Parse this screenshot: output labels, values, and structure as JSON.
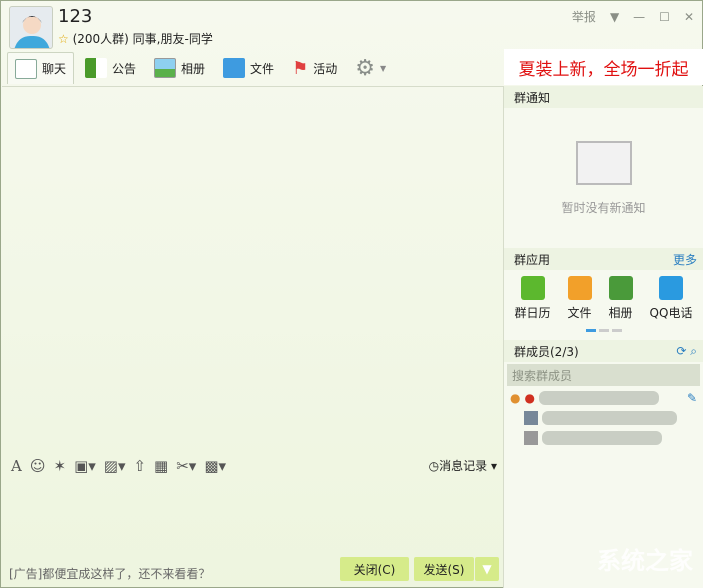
{
  "header": {
    "title": "123",
    "subtitle": "(200人群) 同事,朋友-同学",
    "report": "举报"
  },
  "tabs": [
    {
      "label": "聊天"
    },
    {
      "label": "公告"
    },
    {
      "label": "相册"
    },
    {
      "label": "文件"
    },
    {
      "label": "活动"
    }
  ],
  "ad_banner": "夏装上新，全场一折起",
  "notice": {
    "title": "群通知",
    "empty": "暂时没有新通知"
  },
  "apps": {
    "title": "群应用",
    "more": "更多",
    "items": [
      {
        "label": "群日历"
      },
      {
        "label": "文件"
      },
      {
        "label": "相册"
      },
      {
        "label": "QQ电话"
      }
    ]
  },
  "members": {
    "title": "群成员(2/3)",
    "search_placeholder": "搜索群成员"
  },
  "toolbar": {
    "history": "消息记录"
  },
  "footer": {
    "ad": "[广告]都便宜成这样了，还不来看看？",
    "close": "关闭(C)",
    "send": "发送(S)"
  },
  "watermark": "系统之家",
  "colors": {
    "accent": "#d6eb8a",
    "ad": "#e01010"
  }
}
